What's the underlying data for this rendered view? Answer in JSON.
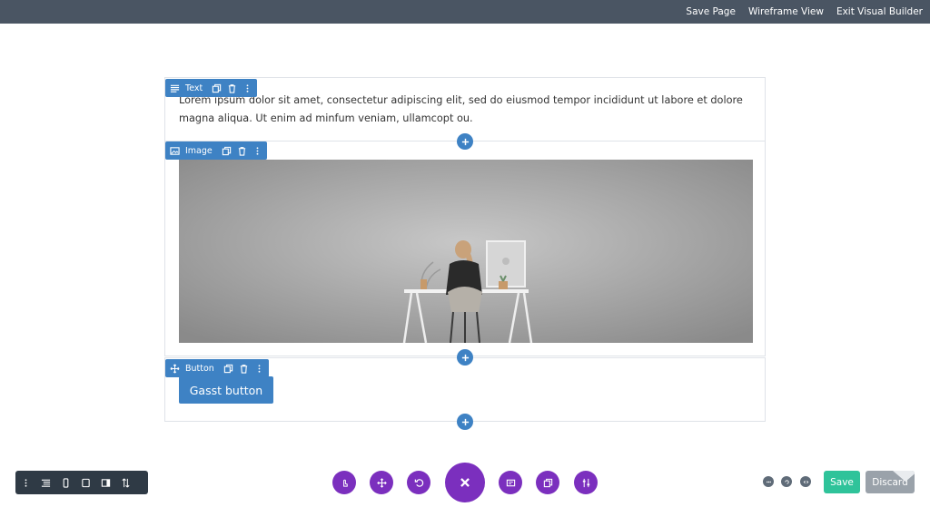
{
  "topbar": {
    "save_page": "Save Page",
    "wireframe_view": "Wireframe View",
    "exit_builder": "Exit Visual Builder"
  },
  "text_module": {
    "label": "Text",
    "body": "Lorem ipsum dolor sit amet, consectetur adipiscing elit, sed do eiusmod tempor incididunt ut labore et dolore magna aliqua. Ut enim ad minfum veniam, ullamcopt ou."
  },
  "image_module": {
    "label": "Image"
  },
  "button_module": {
    "label": "Button",
    "button_text": "Gasst button"
  },
  "footer": {
    "save": "Save",
    "discard": "Discard"
  },
  "colors": {
    "topbar": "#4a5563",
    "module_blue": "#3e82c4",
    "builder_purple": "#7b2fbe",
    "save_green": "#2fc39a",
    "discard_gray": "#9aa2aa"
  }
}
